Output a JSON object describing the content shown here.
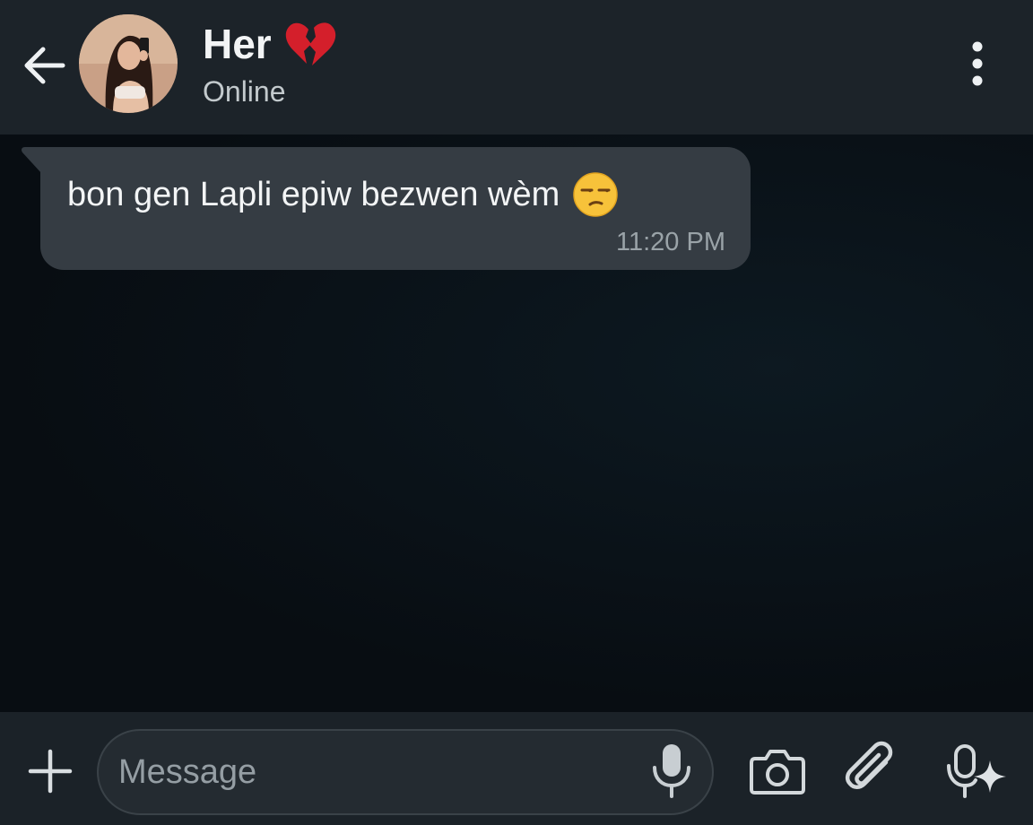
{
  "header": {
    "contact_name": "Her",
    "name_emoji_icon": "broken-heart-icon",
    "status": "Online",
    "back_icon": "arrow-left-icon",
    "menu_icon": "more-vertical-icon"
  },
  "messages": [
    {
      "direction": "incoming",
      "text": "bon gen Lapli epiw bezwen wèm",
      "emoji_icon": "unamused-face-icon",
      "time": "11:20 PM"
    }
  ],
  "composer": {
    "placeholder": "Message",
    "value": "",
    "icons": [
      "plus-icon",
      "microphone-icon",
      "camera-icon",
      "paperclip-icon",
      "ai-voice-icon"
    ]
  },
  "colors": {
    "header_bg": "#1c2329",
    "chat_bg": "#0b1117",
    "bubble_incoming": "#353c43",
    "footer_bg": "#1b2228",
    "heart_red": "#d41f2b"
  }
}
